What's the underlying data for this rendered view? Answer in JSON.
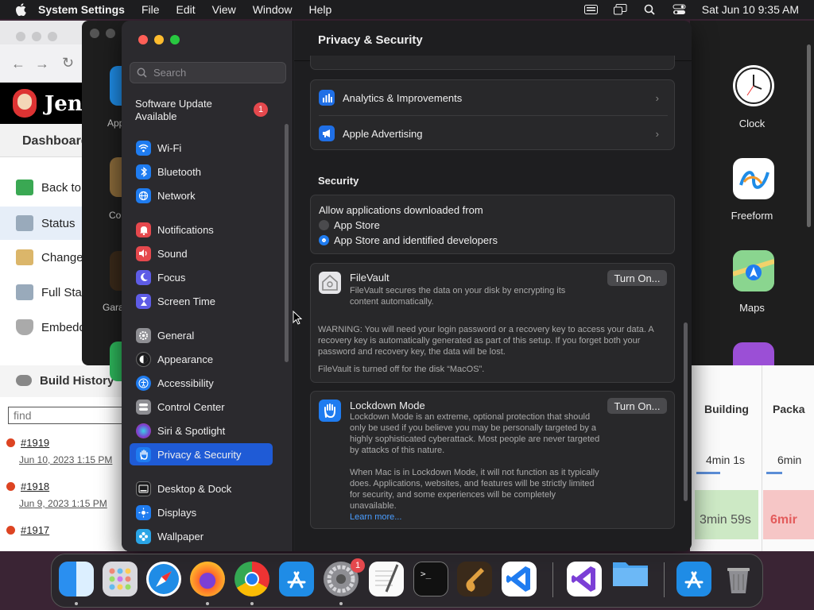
{
  "menubar": {
    "app": "System Settings",
    "items": [
      "File",
      "Edit",
      "View",
      "Window",
      "Help"
    ],
    "clock": "Sat Jun 10  9:35 AM"
  },
  "browser": {
    "brand": "Jen",
    "breadcrumb": "Dashboard",
    "side_items": [
      "Back to",
      "Status",
      "Changes",
      "Full Stage",
      "Embedd"
    ],
    "build_history": "Build History",
    "find_placeholder": "find",
    "builds": [
      {
        "num": "#1919",
        "date": "Jun 10, 2023 1:15 PM"
      },
      {
        "num": "#1918",
        "date": "Jun 9, 2023 1:15 PM"
      },
      {
        "num": "#1917",
        "date": ""
      }
    ]
  },
  "midwin": {
    "labels": [
      "App",
      "Co",
      "Gara"
    ]
  },
  "rightpanel": {
    "apps": [
      "Clock",
      "Freeform",
      "Maps"
    ]
  },
  "stage": {
    "headers": [
      "Building",
      "Packa"
    ],
    "durations_row1": [
      "4min 1s",
      "6min"
    ],
    "durations_row2": [
      "3min 59s",
      "6mir"
    ]
  },
  "settings": {
    "search_placeholder": "Search",
    "update": {
      "line1": "Software Update",
      "line2": "Available",
      "badge": "1"
    },
    "sidebar": [
      {
        "label": "Wi-Fi",
        "icon": "wifi-icon",
        "color": "#1f7cf0"
      },
      {
        "label": "Bluetooth",
        "icon": "bluetooth-icon",
        "color": "#1f7cf0"
      },
      {
        "label": "Network",
        "icon": "network-globe-icon",
        "color": "#1f7cf0"
      },
      {
        "label": "Notifications",
        "icon": "bell-icon",
        "color": "#e5484d"
      },
      {
        "label": "Sound",
        "icon": "speaker-icon",
        "color": "#e5484d"
      },
      {
        "label": "Focus",
        "icon": "moon-icon",
        "color": "#5e5ce6"
      },
      {
        "label": "Screen Time",
        "icon": "hourglass-icon",
        "color": "#5e5ce6"
      },
      {
        "label": "General",
        "icon": "gear-icon",
        "color": "#8e8e93"
      },
      {
        "label": "Appearance",
        "icon": "appearance-icon",
        "color": "#1c1c1e"
      },
      {
        "label": "Accessibility",
        "icon": "accessibility-icon",
        "color": "#1f7cf0"
      },
      {
        "label": "Control Center",
        "icon": "control-center-icon",
        "color": "#8e8e93"
      },
      {
        "label": "Siri & Spotlight",
        "icon": "siri-icon",
        "color": "#7a3fd1"
      },
      {
        "label": "Privacy & Security",
        "icon": "hand-icon",
        "color": "#1f7cf0"
      },
      {
        "label": "Desktop & Dock",
        "icon": "dock-icon",
        "color": "#1c1c1e"
      },
      {
        "label": "Displays",
        "icon": "sun-icon",
        "color": "#1f7cf0"
      },
      {
        "label": "Wallpaper",
        "icon": "flower-icon",
        "color": "#2aa5e6"
      }
    ],
    "title": "Privacy & Security",
    "rows": [
      {
        "label": "Analytics & Improvements",
        "icon": "chart-icon"
      },
      {
        "label": "Apple Advertising",
        "icon": "megaphone-icon"
      }
    ],
    "security": {
      "header": "Security",
      "allow_label": "Allow applications downloaded from",
      "options": [
        "App Store",
        "App Store and identified developers"
      ],
      "selected_option": "App Store and identified developers"
    },
    "filevault": {
      "title": "FileVault",
      "desc": "FileVault secures the data on your disk by encrypting its content automatically.",
      "button": "Turn On...",
      "warning": "WARNING: You will need your login password or a recovery key to access your data. A recovery key is automatically generated as part of this setup. If you forget both your password and recovery key, the data will be lost.",
      "status": "FileVault is turned off for the disk “MacOS”."
    },
    "lockdown": {
      "title": "Lockdown Mode",
      "desc": "Lockdown Mode is an extreme, optional protection that should only be used if you believe you may be personally targeted by a highly sophisticated cyberattack. Most people are never targeted by attacks of this nature.",
      "desc2": "When Mac is in Lockdown Mode, it will not function as it typically does. Applications, websites, and features will be strictly limited for security, and some experiences will be completely unavailable.",
      "link": "Learn more...",
      "button": "Turn On..."
    }
  },
  "dock": {
    "apps": [
      "finder-icon",
      "launchpad-icon",
      "safari-icon",
      "firefox-icon",
      "chrome-icon",
      "app-store-icon",
      "system-settings-icon",
      "textedit-icon",
      "terminal-icon",
      "garageband-icon",
      "vscode-icon",
      "visual-studio-icon",
      "folder-icon",
      "app-store-download-icon",
      "trash-icon"
    ],
    "settings_badge": "1"
  }
}
